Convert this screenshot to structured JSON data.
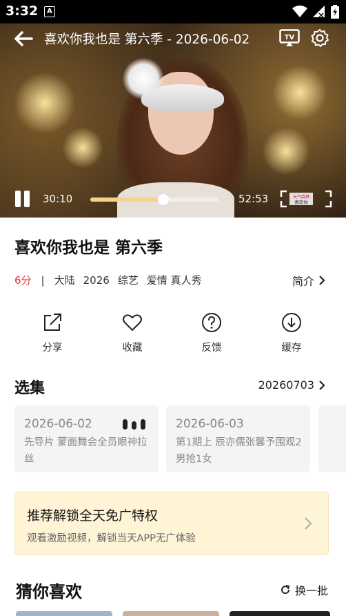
{
  "status_bar": {
    "time": "3:32",
    "notification_badge": "A"
  },
  "player": {
    "title": "喜欢你我也是 第六季 - 2026-06-02",
    "current_time": "30:10",
    "duration": "52:53",
    "progress_fraction": 0.57,
    "cast_label": "TV",
    "watermark": "元气森林 喜欢你我也是"
  },
  "show": {
    "title": "喜欢你我也是 第六季",
    "score": "6分",
    "separator": "|",
    "region": "大陆",
    "year": "2026",
    "category": "综艺",
    "tags": "爱情 真人秀",
    "intro_label": "简介"
  },
  "actions": [
    {
      "label": "分享",
      "icon": "share-icon"
    },
    {
      "label": "收藏",
      "icon": "heart-icon"
    },
    {
      "label": "反馈",
      "icon": "question-icon"
    },
    {
      "label": "缓存",
      "icon": "download-icon"
    }
  ],
  "episodes": {
    "section_title": "选集",
    "latest": "20260703",
    "items": [
      {
        "date": "2026-06-02",
        "desc": "先导片 蒙面舞会全员眼神拉丝",
        "playing": true
      },
      {
        "date": "2026-06-03",
        "desc": "第1期上 辰亦儒张馨予围观2男抢1女",
        "playing": false
      }
    ]
  },
  "promo": {
    "title": "推荐解锁全天免广特权",
    "subtitle": "观看激励视频，解锁当天APP无广体验"
  },
  "recommend": {
    "section_title": "猜你喜欢",
    "refresh_label": "换一批"
  },
  "colors": {
    "accent_red": "#e53935",
    "progress": "#f5d38d",
    "promo_bg": "#fff4d6"
  }
}
